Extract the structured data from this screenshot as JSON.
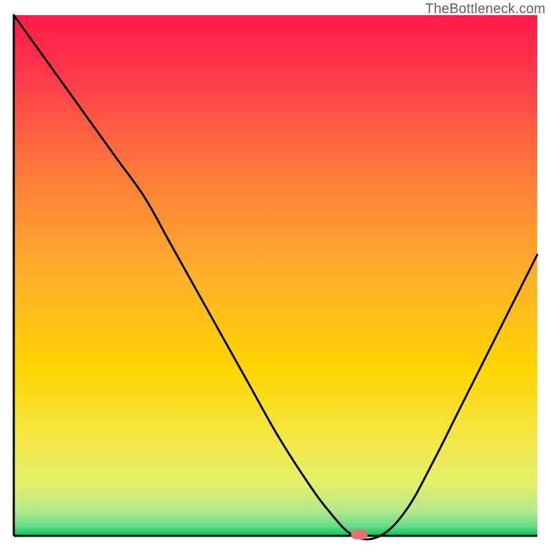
{
  "watermark": "TheBottleneck.com",
  "chart_data": {
    "type": "line",
    "title": "",
    "xlabel": "",
    "ylabel": "",
    "xlim": [
      0,
      100
    ],
    "ylim": [
      0,
      100
    ],
    "x": [
      0,
      5,
      10,
      15,
      20,
      25,
      30,
      35,
      40,
      45,
      50,
      55,
      60,
      65,
      70,
      75,
      80,
      85,
      90,
      95,
      100
    ],
    "values": [
      100,
      93,
      86,
      79,
      72,
      65,
      56,
      47,
      38,
      29,
      20,
      12,
      5,
      0,
      0,
      5,
      14,
      24,
      34,
      44,
      54
    ],
    "minimum_marker": {
      "x": 66,
      "y": 0
    },
    "colors": {
      "gradient_top": "#ff1a4a",
      "gradient_mid": "#ffd500",
      "gradient_bottom": "#00c853",
      "curve": "#000000",
      "axes": "#000000",
      "marker": "#e57373"
    }
  }
}
